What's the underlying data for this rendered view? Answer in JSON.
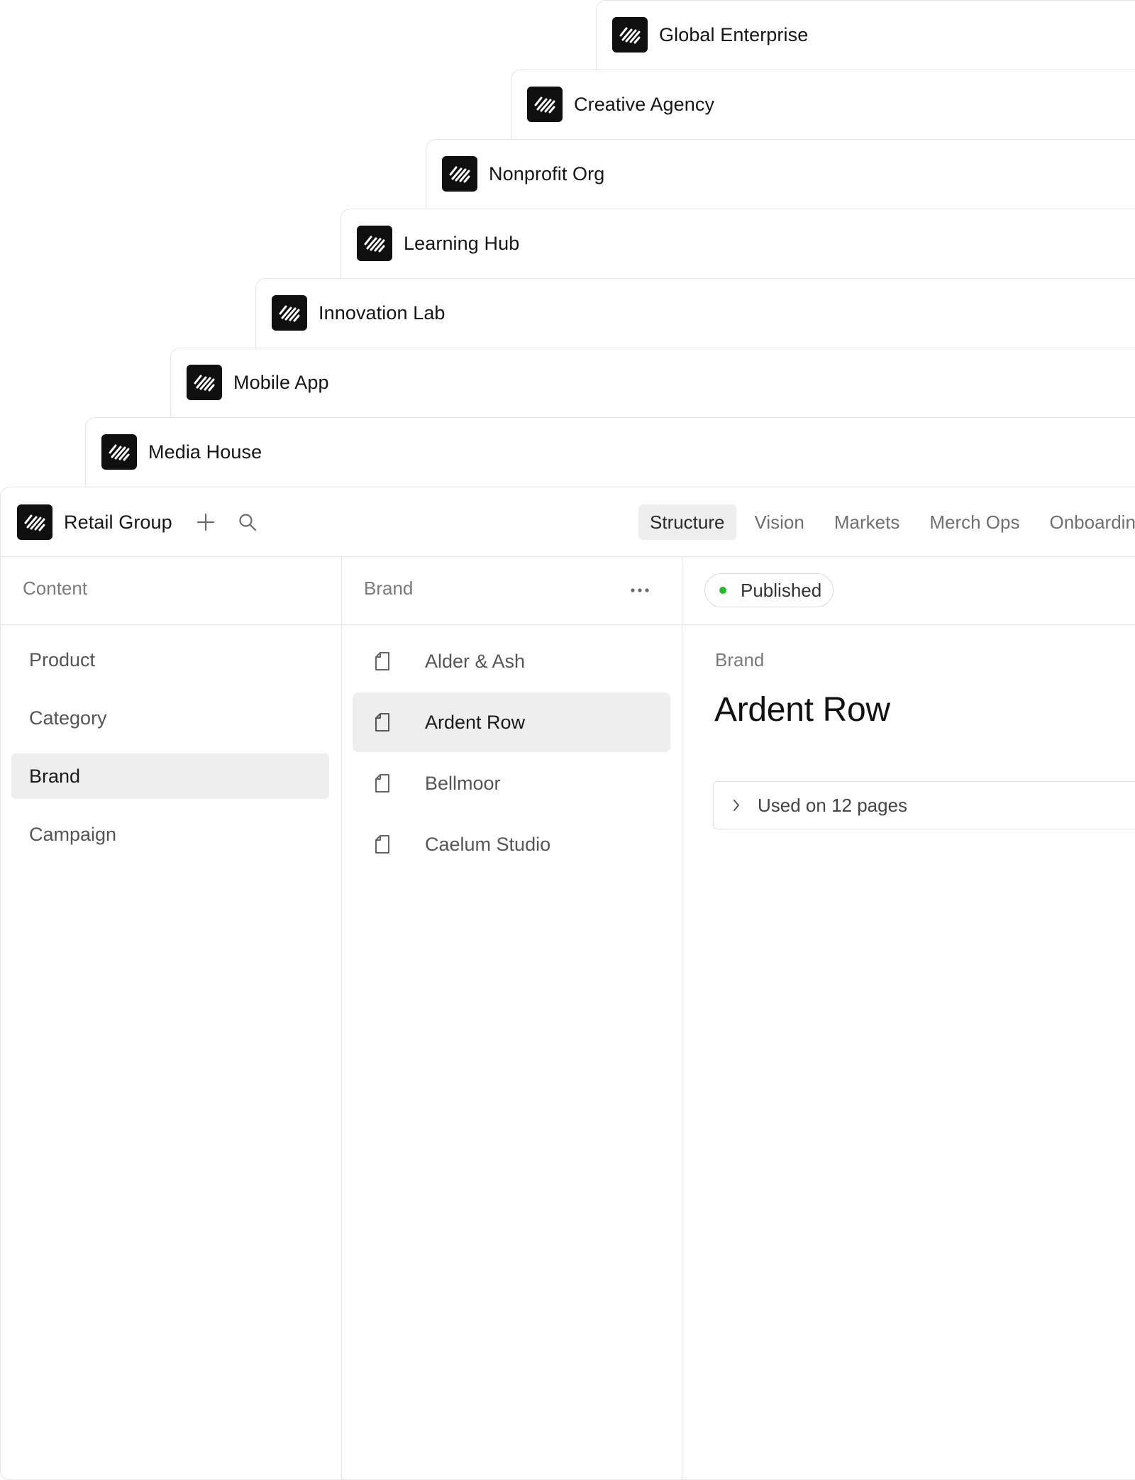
{
  "workspaces": [
    {
      "name": "Global Enterprise"
    },
    {
      "name": "Creative Agency"
    },
    {
      "name": "Nonprofit Org"
    },
    {
      "name": "Learning Hub"
    },
    {
      "name": "Innovation Lab"
    },
    {
      "name": "Mobile App"
    },
    {
      "name": "Media House"
    }
  ],
  "main": {
    "workspace_name": "Retail Group",
    "add_icon": "plus-icon",
    "search_icon": "search-icon",
    "tabs": [
      {
        "label": "Structure",
        "active": true
      },
      {
        "label": "Vision",
        "active": false
      },
      {
        "label": "Markets",
        "active": false
      },
      {
        "label": "Merch Ops",
        "active": false
      },
      {
        "label": "Onboarding",
        "active": false
      }
    ],
    "content_column": {
      "header": "Content",
      "items": [
        {
          "label": "Product",
          "active": false
        },
        {
          "label": "Category",
          "active": false
        },
        {
          "label": "Brand",
          "active": true
        },
        {
          "label": "Campaign",
          "active": false
        }
      ]
    },
    "list_column": {
      "header": "Brand",
      "menu_icon": "more-horizontal-icon",
      "items": [
        {
          "label": "Alder & Ash",
          "active": false
        },
        {
          "label": "Ardent Row",
          "active": true
        },
        {
          "label": "Bellmoor",
          "active": false
        },
        {
          "label": "Caelum Studio",
          "active": false
        }
      ]
    },
    "detail": {
      "status": "Published",
      "status_color": "#19c21f",
      "type_label": "Brand",
      "title": "Ardent Row",
      "usage_text": "Used on 12  pages"
    }
  }
}
